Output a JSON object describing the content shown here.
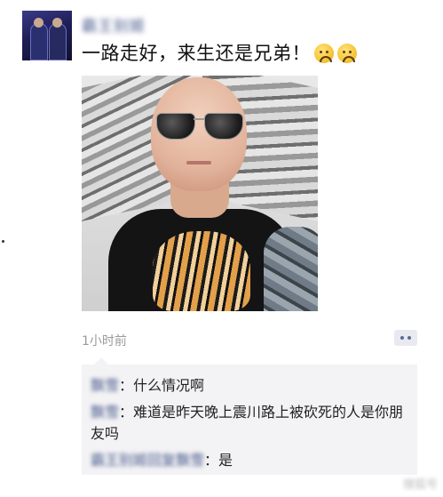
{
  "post": {
    "author": "霸王别姬",
    "text": "一路走好，来生还是兄弟！",
    "emojis": [
      "sad-face-icon",
      "sad-face-icon"
    ],
    "time": "1小时前"
  },
  "comments": [
    {
      "name": "飘雪",
      "text": "什么情况啊"
    },
    {
      "name": "飘雪",
      "text": "难道是昨天晚上震川路上被砍死的人是你朋友吗"
    },
    {
      "name": "霸王别姬回复飘雪",
      "text": "是"
    }
  ],
  "watermark": "搜狐号"
}
